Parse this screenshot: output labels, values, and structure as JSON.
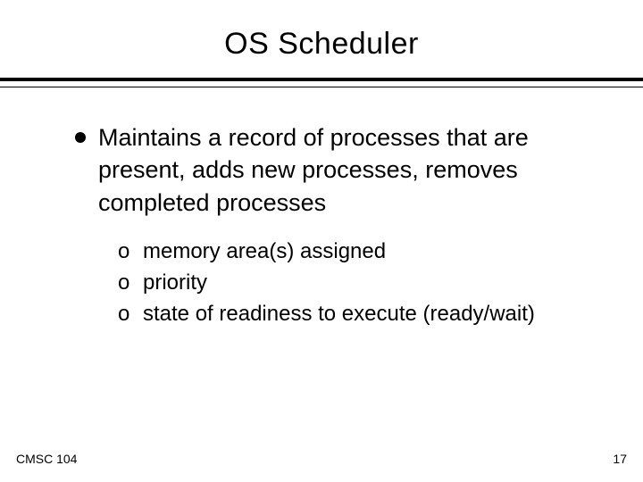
{
  "title": "OS Scheduler",
  "bullet": "Maintains a record of processes that are present, adds new processes, removes completed processes",
  "subs": {
    "marker": "o",
    "items": [
      "memory area(s) assigned",
      "priority",
      "state of readiness to execute (ready/wait)"
    ]
  },
  "footer": {
    "left": "CMSC 104",
    "right": "17"
  }
}
